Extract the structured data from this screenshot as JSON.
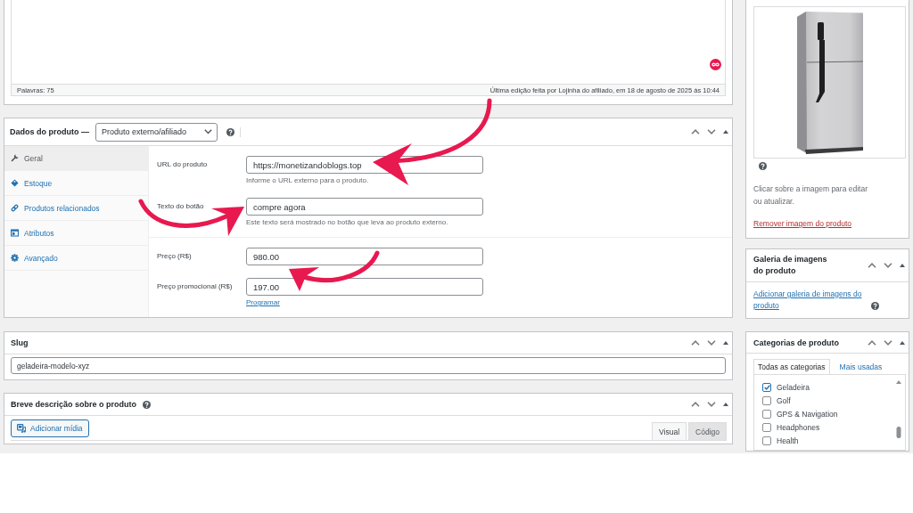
{
  "editor": {
    "word_count": "Palavras: 75",
    "last_edit": "Última edição feita por Lojinha do afiliado, em 18 de agosto de 2025 às 10:44"
  },
  "product_data": {
    "title": "Dados do produto —",
    "product_type": "Produto externo/afiliado",
    "tabs": [
      {
        "kind": "general",
        "label": "Geral",
        "selected": true
      },
      {
        "kind": "inventory",
        "label": "Estoque",
        "selected": false
      },
      {
        "kind": "linked",
        "label": "Produtos relacionados",
        "selected": false
      },
      {
        "kind": "attributes",
        "label": "Atributos",
        "selected": false
      },
      {
        "kind": "advanced",
        "label": "Avançado",
        "selected": false
      }
    ],
    "groups": [
      {
        "fields": [
          {
            "label": "URL do produto",
            "value": "https://monetizandoblogs.top",
            "description": "Informe o URL externo para o produto."
          },
          {
            "label": "Texto do botão",
            "value": "compre agora",
            "description": "Este texto será mostrado no botão que leva ao produto externo."
          }
        ]
      },
      {
        "fields": [
          {
            "label": "Preço (R$)",
            "value": "980.00"
          },
          {
            "label": "Preço promocional (R$)",
            "value": "197.00",
            "link": "Programar"
          }
        ]
      }
    ]
  },
  "slug": {
    "title": "Slug",
    "value": "geladeira-modelo-xyz"
  },
  "short_description": {
    "title": "Breve descrição sobre o produto",
    "add_media": "Adicionar mídia",
    "tabs": [
      {
        "label": "Visual",
        "selected": true
      },
      {
        "label": "Código",
        "selected": false
      }
    ]
  },
  "product_image": {
    "hint": "Clicar sobre a imagem para editar ou atualizar.",
    "remove_link": "Remover imagem do produto"
  },
  "gallery": {
    "title": "Galeria de imagens do produto",
    "add_link": "Adicionar galeria de imagens do produto"
  },
  "categories": {
    "title": "Categorias de produto",
    "tabs": [
      {
        "label": "Todas as categorias",
        "selected": true
      },
      {
        "label": "Mais usadas",
        "selected": false
      }
    ],
    "items": [
      {
        "label": "Geladeira",
        "checked": true
      },
      {
        "label": "Golf",
        "checked": false
      },
      {
        "label": "GPS & Navigation",
        "checked": false
      },
      {
        "label": "Headphones",
        "checked": false
      },
      {
        "label": "Health",
        "checked": false
      }
    ]
  }
}
